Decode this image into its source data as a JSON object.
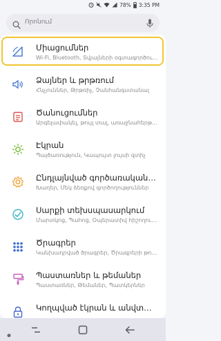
{
  "status": {
    "battery": "78%",
    "time": "3:35 PM"
  },
  "search": {
    "placeholder": "Որոնում"
  },
  "menu": [
    {
      "title": "Միացումներ",
      "subtitle": "Wi-Fi, Bluetooth, Տվյալների օգտագործում, Թռիչքային ռեժիմ",
      "icon": "connections-icon",
      "color": "#4a7bd6"
    },
    {
      "title": "Ձայներ և թրթռում",
      "subtitle": "Հնչյուններ, Թրթռիչ, Չանհանգստանալ",
      "icon": "sound-icon",
      "color": "#4a7bd6"
    },
    {
      "title": "Ծանուցումներ",
      "subtitle": "Արգելափակել, թույլ տալ, առաջնահերթություն",
      "icon": "notifications-icon",
      "color": "#d9534f"
    },
    {
      "title": "Էկրան",
      "subtitle": "Պայծառություն, Կապույտ լույսի զտիչ",
      "icon": "display-icon",
      "color": "#7cbd3a"
    },
    {
      "title": "Ընդլայնված գործառականություններ",
      "subtitle": "Խաղեր, Մեկ ձեռքով գործողություններ",
      "icon": "advanced-features-icon",
      "color": "#f0a032"
    },
    {
      "title": "Սարքի տեխսպասարկում",
      "subtitle": "Մարտկոց, Պահոց, Օպերատիվ հիշողություն",
      "icon": "device-maintenance-icon",
      "color": "#3cb5c8"
    },
    {
      "title": "Ծրագրեր",
      "subtitle": "Կանխադրված ծրագրեր, Ծրագրերի թույլտվություններ",
      "icon": "apps-icon",
      "color": "#3a6ad0"
    },
    {
      "title": "Պաստառներ և թեմաներ",
      "subtitle": "Պաստառներ, Թեմաներ, Պատկերներ",
      "icon": "wallpapers-themes-icon",
      "color": "#c85fbf"
    },
    {
      "title": "Կողպված էկրան և անվտանգություն",
      "subtitle": "",
      "icon": "lock-screen-icon",
      "color": "#4a6ad0"
    }
  ]
}
